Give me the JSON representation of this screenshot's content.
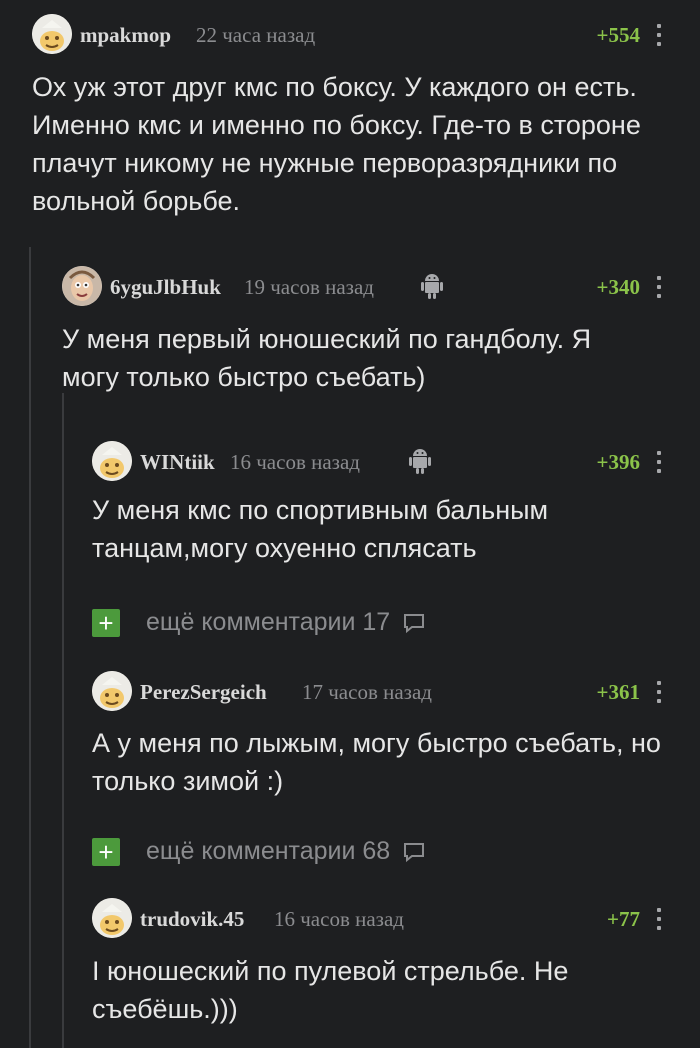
{
  "comments": [
    {
      "username": "mpakmop",
      "time": "22 часа назад",
      "rating": "+554",
      "text": "Ох уж этот друг кмс по боксу. У каждого он есть. Именно кмс и именно по боксу. Где-то в стороне плачут никому не нужные перворазрядники по вольной борьбе.",
      "avatar_icon": "pikabu-default-avatar-icon"
    },
    {
      "username": "6yguJlbHuk",
      "time": "19 часов назад",
      "rating": "+340",
      "text": "У меня первый юношеский по гандболу. Я могу только быстро съебать)",
      "avatar_icon": "custom-avatar-icon",
      "device_icon": "android-icon"
    },
    {
      "username": "WINtiik",
      "time": "16 часов назад",
      "rating": "+396",
      "text": "У меня кмс по спортивным бальным танцам,могу охуенно сплясать",
      "avatar_icon": "pikabu-default-avatar-icon",
      "device_icon": "android-icon"
    },
    {
      "username": "PerezSergeich",
      "time": "17 часов назад",
      "rating": "+361",
      "text": "А у меня по лыжым, могу быстро съебать, но только зимой :)",
      "avatar_icon": "pikabu-default-avatar-icon"
    },
    {
      "username": "trudovik.45",
      "time": "16 часов назад",
      "rating": "+77",
      "text": "I юношеский по пулевой стрельбе. Не съебёшь.)))",
      "avatar_icon": "pikabu-default-avatar-icon"
    }
  ],
  "more_comments": [
    {
      "label": "ещё комментарии 17"
    },
    {
      "label": "ещё комментарии 68"
    }
  ],
  "colors": {
    "background": "#1e1f21",
    "rating": "#8bc34a",
    "plus_button": "#4c9a3c",
    "muted": "#8b8c8f"
  }
}
